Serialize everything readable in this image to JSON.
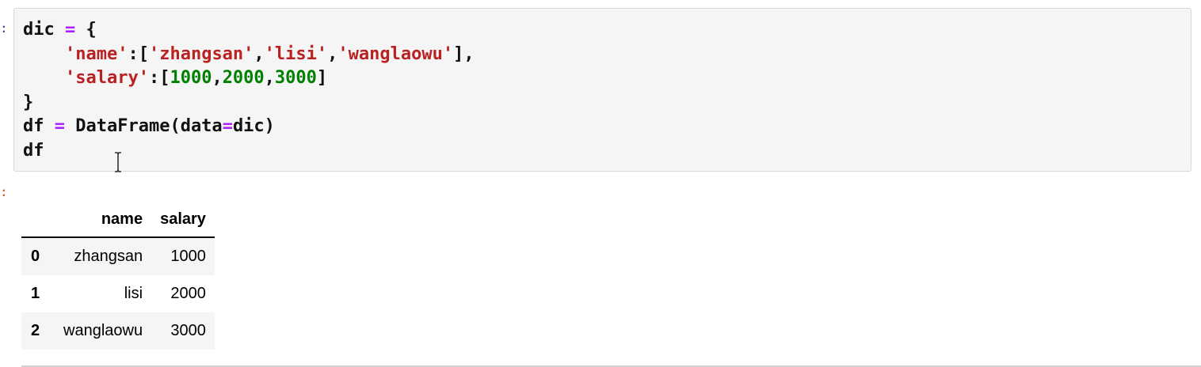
{
  "notebook": {
    "input_prompt": ":",
    "output_prompt": ":",
    "code_lines": [
      [
        {
          "t": "dic ",
          "c": "plain"
        },
        {
          "t": "=",
          "c": "op"
        },
        {
          "t": " {",
          "c": "plain"
        }
      ],
      [
        {
          "t": "    ",
          "c": "plain"
        },
        {
          "t": "'name'",
          "c": "str"
        },
        {
          "t": ":[",
          "c": "plain"
        },
        {
          "t": "'zhangsan'",
          "c": "str"
        },
        {
          "t": ",",
          "c": "plain"
        },
        {
          "t": "'lisi'",
          "c": "str"
        },
        {
          "t": ",",
          "c": "plain"
        },
        {
          "t": "'wanglaowu'",
          "c": "str"
        },
        {
          "t": "],",
          "c": "plain"
        }
      ],
      [
        {
          "t": "    ",
          "c": "plain"
        },
        {
          "t": "'salary'",
          "c": "str"
        },
        {
          "t": ":[",
          "c": "plain"
        },
        {
          "t": "1000",
          "c": "num"
        },
        {
          "t": ",",
          "c": "plain"
        },
        {
          "t": "2000",
          "c": "num"
        },
        {
          "t": ",",
          "c": "plain"
        },
        {
          "t": "3000",
          "c": "num"
        },
        {
          "t": "]",
          "c": "plain"
        }
      ],
      [
        {
          "t": "}",
          "c": "plain"
        }
      ],
      [
        {
          "t": "df ",
          "c": "plain"
        },
        {
          "t": "=",
          "c": "op"
        },
        {
          "t": " DataFrame(data",
          "c": "plain"
        },
        {
          "t": "=",
          "c": "op"
        },
        {
          "t": "dic)",
          "c": "plain"
        }
      ],
      [
        {
          "t": "df",
          "c": "plain"
        }
      ]
    ],
    "output_table": {
      "columns": [
        "",
        "name",
        "salary"
      ],
      "rows": [
        [
          "0",
          "zhangsan",
          "1000"
        ],
        [
          "1",
          "lisi",
          "2000"
        ],
        [
          "2",
          "wanglaowu",
          "3000"
        ]
      ]
    },
    "colors": {
      "operator": "#aa22ff",
      "string": "#ba2121",
      "number": "#008000",
      "input_background": "#f5f5f5"
    },
    "cursor_icon": "text-cursor-ibeam"
  }
}
